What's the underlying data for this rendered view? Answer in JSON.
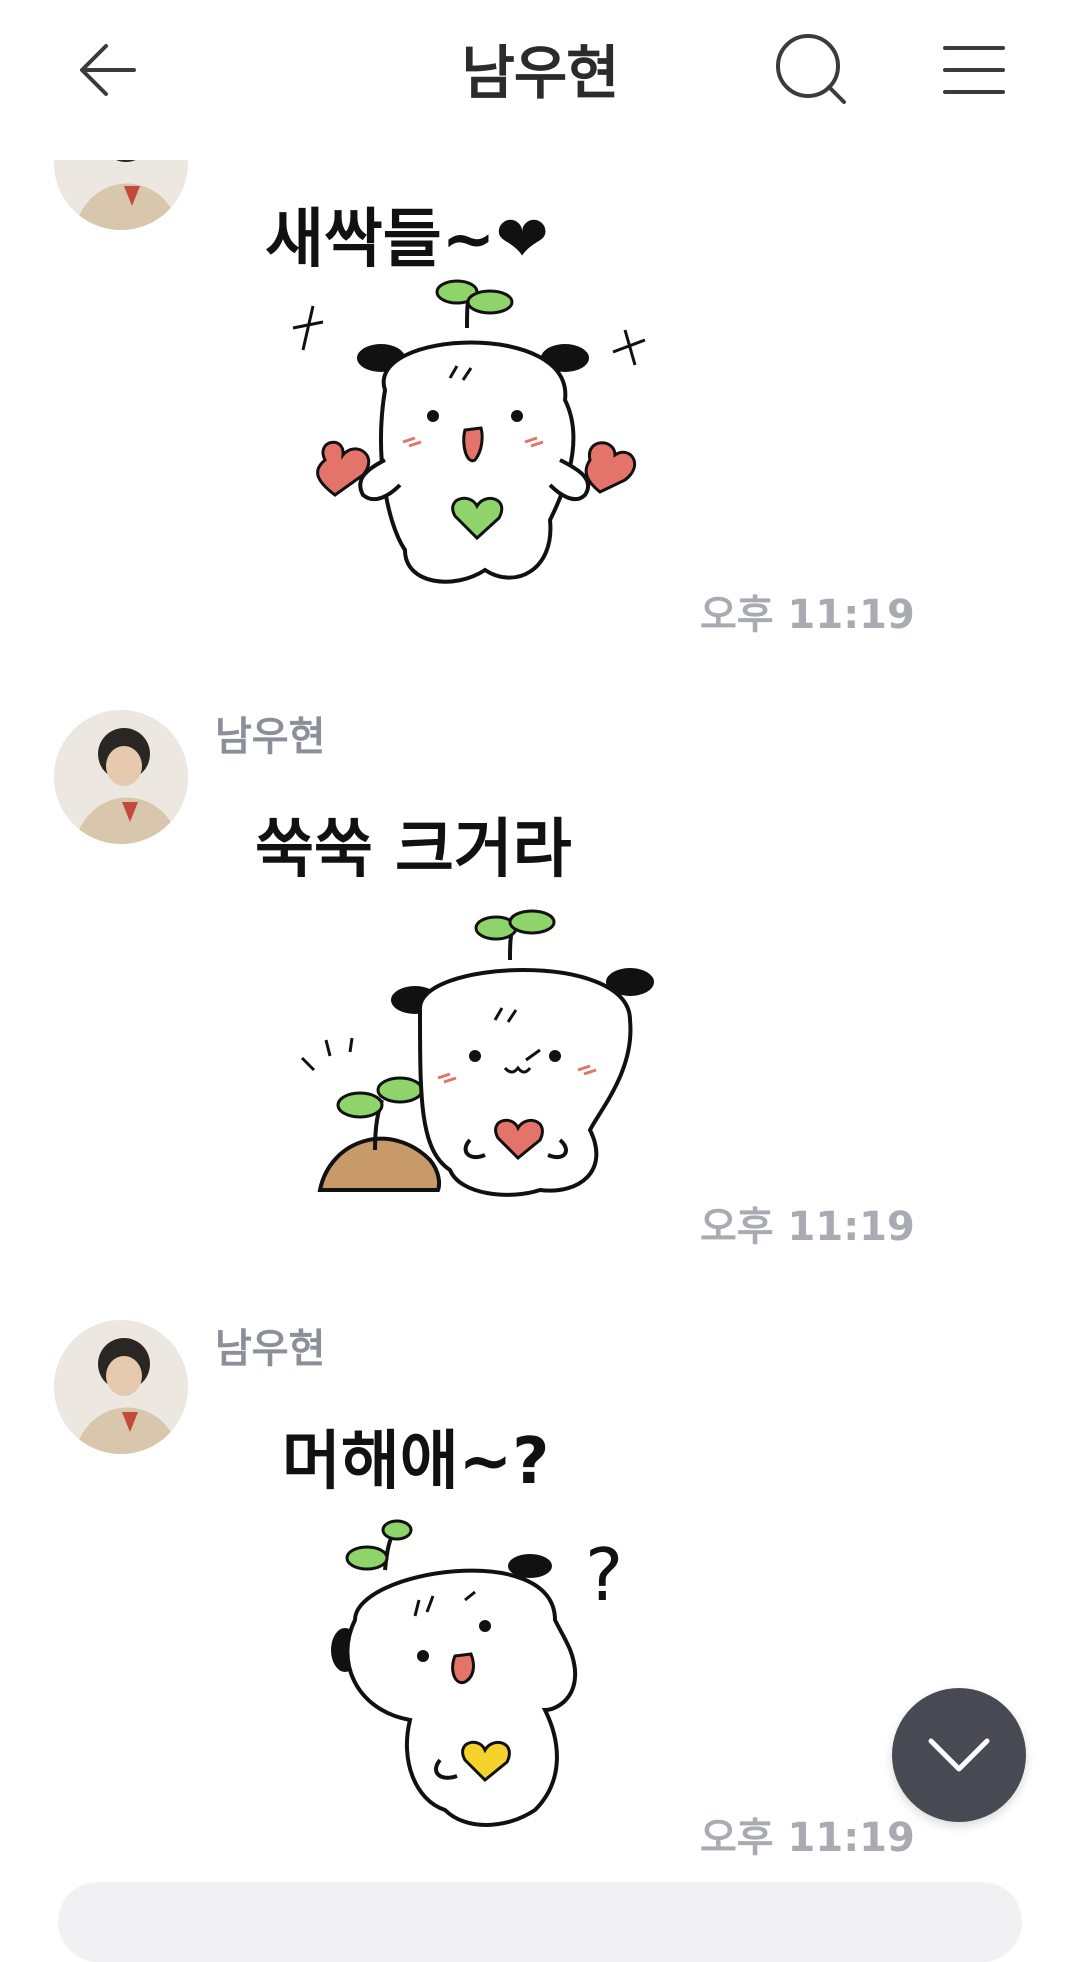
{
  "header": {
    "title": "남우현",
    "back_icon": "arrow-left-icon",
    "search_icon": "search-icon",
    "menu_icon": "hamburger-menu-icon"
  },
  "messages": [
    {
      "sender": "",
      "sticker_caption": "새싹들~❤",
      "sticker_icon": "sprout-bear-hearts-sticker",
      "time": "오후 11:19"
    },
    {
      "sender": "남우현",
      "sticker_caption": "쑥쑥 크거라",
      "sticker_icon": "sprout-bear-planting-sticker",
      "time": "오후 11:19"
    },
    {
      "sender": "남우현",
      "sticker_caption": "머해애~?",
      "sticker_icon": "sprout-bear-question-sticker",
      "time": "오후 11:19"
    }
  ],
  "scroll_button": {
    "icon": "chevron-down-icon"
  },
  "colors": {
    "sprout": "#8fd36b",
    "heart_red": "#e4736a",
    "heart_green": "#8fd36b",
    "heart_yellow": "#f5d22c",
    "time_text": "#a8abb2",
    "sender_text": "#8a8f98",
    "fab_bg": "#474a52"
  }
}
